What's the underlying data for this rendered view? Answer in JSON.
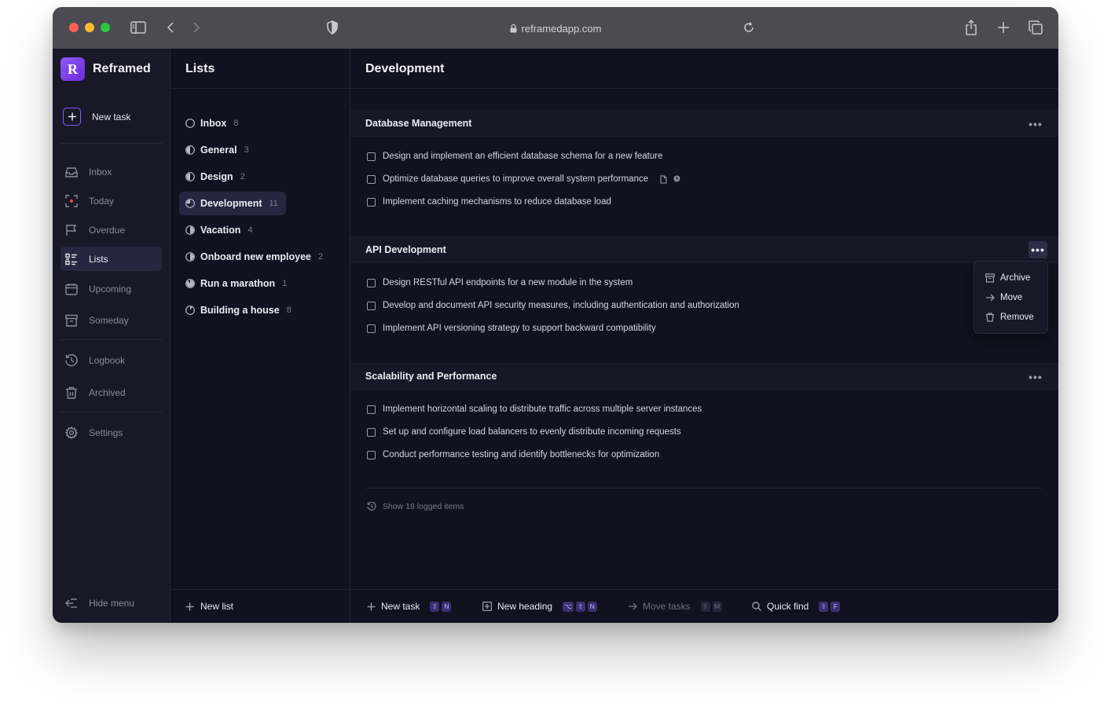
{
  "browser": {
    "url": "reframedapp.com"
  },
  "brand": {
    "logo_letter": "R",
    "name": "Reframed"
  },
  "sidebar": {
    "new_task": "New task",
    "items": [
      {
        "label": "Inbox",
        "icon": "inbox-icon"
      },
      {
        "label": "Today",
        "icon": "today-icon"
      },
      {
        "label": "Overdue",
        "icon": "flag-icon"
      },
      {
        "label": "Lists",
        "icon": "lists-icon",
        "active": true
      },
      {
        "label": "Upcoming",
        "icon": "calendar-icon"
      },
      {
        "label": "Someday",
        "icon": "archive-box-icon"
      },
      {
        "label": "Logbook",
        "icon": "clock-icon"
      },
      {
        "label": "Archived",
        "icon": "trash-icon"
      },
      {
        "label": "Settings",
        "icon": "gear-icon"
      }
    ],
    "hide_menu": "Hide menu"
  },
  "lists": {
    "title": "Lists",
    "items": [
      {
        "name": "Inbox",
        "count": "8",
        "progress": 0
      },
      {
        "name": "General",
        "count": "3",
        "progress": 0.5
      },
      {
        "name": "Design",
        "count": "2",
        "progress": 0.5
      },
      {
        "name": "Development",
        "count": "11",
        "progress": 0.25,
        "active": true
      },
      {
        "name": "Vacation",
        "count": "4",
        "progress": 0.25
      },
      {
        "name": "Onboard new employee",
        "count": "2",
        "progress": 0.5
      },
      {
        "name": "Run a marathon",
        "count": "1",
        "progress": 0.9
      },
      {
        "name": "Building a house",
        "count": "8",
        "progress": 0.1
      }
    ],
    "new_list": "New list"
  },
  "main": {
    "title": "Development",
    "sections": [
      {
        "heading": "Database Management",
        "tasks": [
          "Design and implement an efficient database schema for a new feature",
          "Optimize database queries to improve overall system performance",
          "Implement caching mechanisms to reduce database load"
        ]
      },
      {
        "heading": "API Development",
        "tasks": [
          "Design RESTful API endpoints for a new module in the system",
          "Develop and document API security measures, including authentication and authorization",
          "Implement API versioning strategy to support backward compatibility"
        ]
      },
      {
        "heading": "Scalability and Performance",
        "tasks": [
          "Implement horizontal scaling to distribute traffic across multiple server instances",
          "Set up and configure load balancers to evenly distribute incoming requests",
          "Conduct performance testing and identify bottlenecks for optimization"
        ]
      }
    ],
    "context_menu": {
      "archive": "Archive",
      "move": "Move",
      "remove": "Remove"
    },
    "show_logged": "Show 18 logged items"
  },
  "footer": {
    "new_task": {
      "label": "New task",
      "keys": [
        "⇧",
        "N"
      ]
    },
    "new_heading": {
      "label": "New heading",
      "keys": [
        "⌥",
        "⇧",
        "N"
      ]
    },
    "move_tasks": {
      "label": "Move tasks",
      "keys": [
        "⇧",
        "M"
      ]
    },
    "quick_find": {
      "label": "Quick find",
      "keys": [
        "⇧",
        "F"
      ]
    }
  },
  "colors": {
    "accent": "#8b5cf6",
    "background": "#11111f",
    "sidebar": "#181827",
    "active_item": "#262640"
  }
}
